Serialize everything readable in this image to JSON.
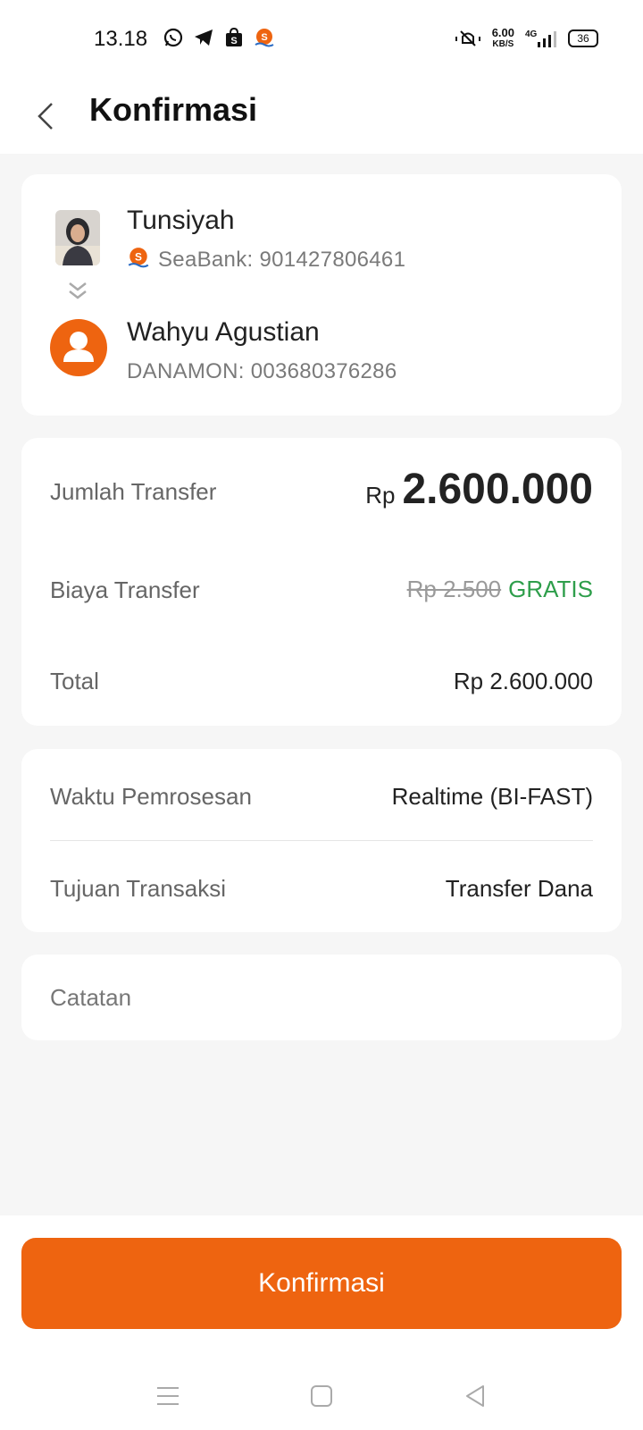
{
  "status_bar": {
    "time": "13.18",
    "speed_value": "6.00",
    "speed_unit": "KB/S",
    "network": "4G",
    "battery": "36"
  },
  "header": {
    "title": "Konfirmasi"
  },
  "sender": {
    "name": "Tunsiyah",
    "account": "SeaBank: 901427806461"
  },
  "recipient": {
    "name": "Wahyu Agustian",
    "account": "DANAMON: 003680376286"
  },
  "amounts": {
    "transfer_label": "Jumlah Transfer",
    "transfer_currency": "Rp",
    "transfer_value": "2.600.000",
    "fee_label": "Biaya Transfer",
    "fee_original": "Rp 2.500",
    "fee_free": "GRATIS",
    "total_label": "Total",
    "total_value": "Rp 2.600.000"
  },
  "details": {
    "processing_label": "Waktu Pemrosesan",
    "processing_value": "Realtime (BI-FAST)",
    "purpose_label": "Tujuan Transaksi",
    "purpose_value": "Transfer Dana"
  },
  "notes": {
    "placeholder": "Catatan"
  },
  "confirm_button": {
    "label": "Konfirmasi"
  },
  "colors": {
    "accent": "#ee6410",
    "free": "#2e9e4b"
  },
  "icons": [
    "whatsapp-icon",
    "telegram-icon",
    "shopee-icon",
    "seabank-icon",
    "mute-icon",
    "signal-icon",
    "battery-icon",
    "back-icon",
    "double-chevron-down-icon",
    "user-icon",
    "menu-icon",
    "home-icon",
    "back-nav-icon"
  ]
}
